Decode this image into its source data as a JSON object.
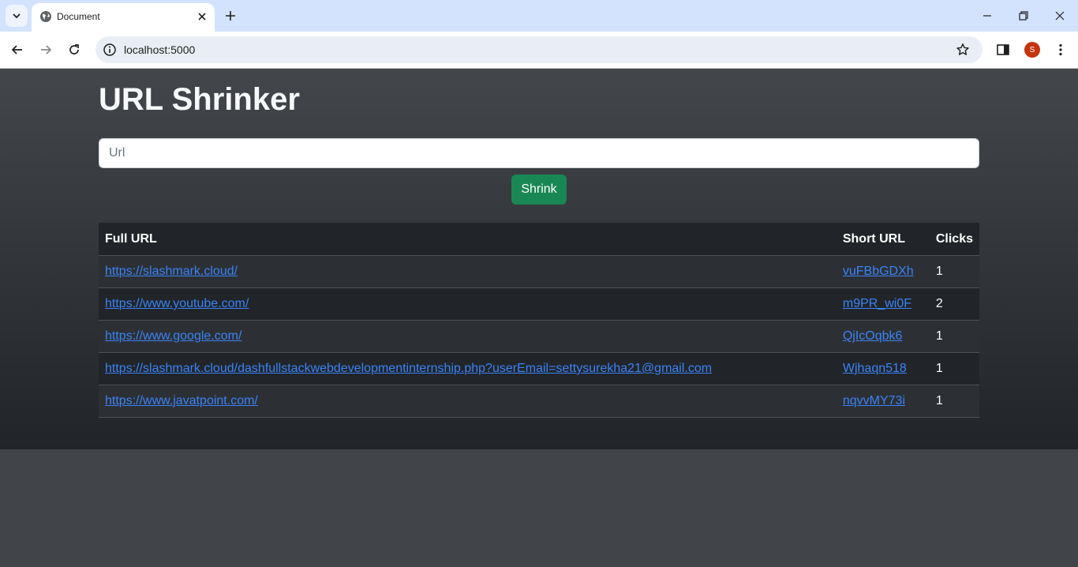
{
  "browser": {
    "tab_title": "Document",
    "address": "localhost:5000",
    "profile_initial": "S"
  },
  "page": {
    "title": "URL Shrinker",
    "input_placeholder": "Url",
    "input_value": "",
    "shrink_label": "Shrink"
  },
  "table": {
    "headers": [
      "Full URL",
      "Short URL",
      "Clicks"
    ],
    "rows": [
      {
        "full": "https://slashmark.cloud/",
        "short": "vuFBbGDXh",
        "clicks": "1"
      },
      {
        "full": "https://www.youtube.com/",
        "short": "m9PR_wi0F",
        "clicks": "2"
      },
      {
        "full": "https://www.google.com/",
        "short": "QjIcOqbk6",
        "clicks": "1"
      },
      {
        "full": "https://slashmark.cloud/dashfullstackwebdevelopmentinternship.php?userEmail=settysurekha21@gmail.com",
        "short": "Wjhaqn518",
        "clicks": "1"
      },
      {
        "full": "https://www.javatpoint.com/",
        "short": "nqvvMY73i",
        "clicks": "1"
      }
    ]
  },
  "colors": {
    "accent_button": "#198754",
    "link": "#3b82f6",
    "table_dark": "#212529",
    "tabstrip": "#d3e3fd"
  }
}
